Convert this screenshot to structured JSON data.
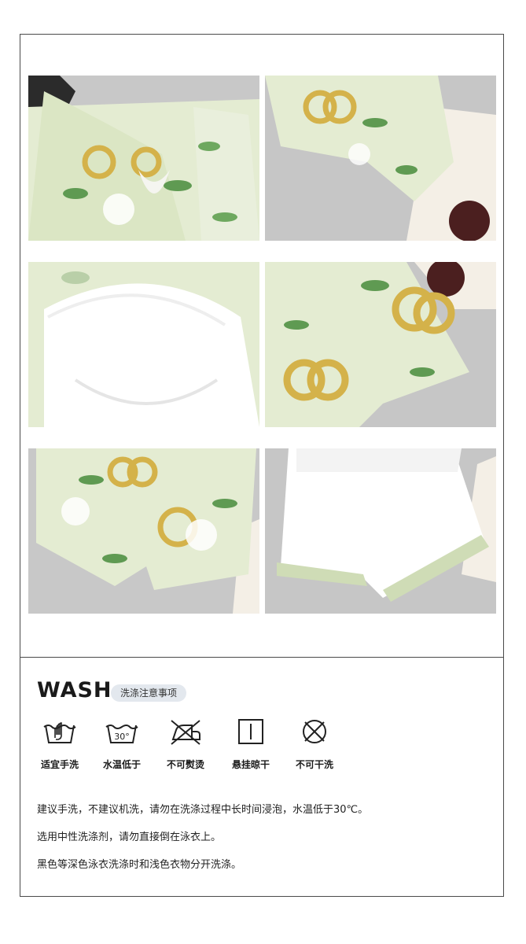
{
  "photos": [
    {
      "name": "floral-top-front"
    },
    {
      "name": "floral-sleeve-detail"
    },
    {
      "name": "bra-cup-lining-detail"
    },
    {
      "name": "floral-fabric-detail"
    },
    {
      "name": "floral-shorts-front"
    },
    {
      "name": "shorts-white-lining"
    }
  ],
  "wash": {
    "title": "WASH",
    "subtitle": "洗涤注意事项",
    "care_icons": [
      {
        "icon": "hand-wash-icon",
        "label": "适宜手洗"
      },
      {
        "icon": "wash-30-icon",
        "label": "水温低于",
        "temp": "30°"
      },
      {
        "icon": "no-iron-icon",
        "label": "不可熨烫"
      },
      {
        "icon": "hang-dry-icon",
        "label": "悬挂晾干"
      },
      {
        "icon": "no-dry-clean-icon",
        "label": "不可干洗"
      }
    ],
    "notes": [
      "建议手洗，不建议机洗，请勿在洗涤过程中长时间浸泡，水温低于30℃。",
      "选用中性洗涤剂，请勿直接倒在泳衣上。",
      "黑色等深色泳衣洗涤时和浅色衣物分开洗涤。"
    ]
  },
  "colors": {
    "border": "#4a4a4a",
    "fabric_green": "#dfe8cc",
    "leaf": "#5f9a52",
    "ring_gold": "#d4b24a",
    "background_gray": "#c9c9c9"
  }
}
